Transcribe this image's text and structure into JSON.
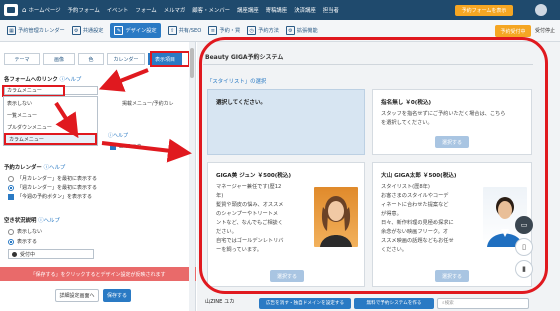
{
  "topbar": {
    "items": [
      "ホームページ",
      "予約フォーム",
      "イベント",
      "フォーム",
      "メルマガ",
      "顧客・メンバー",
      "講座講座",
      "寄稿講座",
      "決済講座",
      "担当者"
    ],
    "reserve_button": "予約フォームを表示",
    "home_icon": "home-icon"
  },
  "toolbar": {
    "items": [
      {
        "label": "予約管理カレンダー",
        "icon": "calendar-icon"
      },
      {
        "label": "共通設定",
        "icon": "gear-icon"
      },
      {
        "label": "デザイン設定",
        "icon": "brush-icon",
        "active": true
      },
      {
        "label": "共有/SEO",
        "icon": "share-icon"
      },
      {
        "label": "予約・買",
        "icon": "list-icon"
      },
      {
        "label": "予約方法",
        "icon": "clock-icon"
      },
      {
        "label": "拡張機能",
        "icon": "gear-icon"
      }
    ],
    "reserve_label": "予約受付中",
    "user_label": "受付停止"
  },
  "left_panel": {
    "tabs": [
      {
        "label": "テーマ",
        "active": false
      },
      {
        "label": "画像",
        "active": false
      },
      {
        "label": "色",
        "active": false
      },
      {
        "label": "カレンダー",
        "active": false
      },
      {
        "label": "表示項目",
        "active": true
      }
    ],
    "menu_link": {
      "label": "各フォームへのリンク",
      "help": "ヘルプ",
      "selected": "カラムメニュー",
      "options": [
        "表示しない",
        "一覧メニュー",
        "プルダウンメニュー",
        "カラムメニュー"
      ],
      "behind_text": "掲載メニュー/予約カレ"
    },
    "behind_help": "ヘルプ",
    "behind_check": "LINE ユカ",
    "calendar": {
      "label": "予約カレンダー",
      "help": "ヘルプ",
      "options": [
        {
          "label": "「月カレンダー」を最初に表示する",
          "checked": false
        },
        {
          "label": "「週カレンダー」を最初に表示する",
          "checked": true
        },
        {
          "label": "「今週の予約ボタン」を表示する",
          "checked": true
        }
      ]
    },
    "status": {
      "label": "空き状況説明",
      "help": "ヘルプ",
      "options": [
        {
          "label": "表示しない",
          "checked": false
        },
        {
          "label": "表示する",
          "checked": true
        }
      ],
      "slider_label": "受付中"
    },
    "warning": "「保存する」をクリックするとデザイン設定が反映されます",
    "detail_button": "詳細設定画面へ",
    "save_button": "保存する"
  },
  "preview": {
    "title": "Beauty GIGA予約システム",
    "subtitle": "「スタイリスト」の選択",
    "cards": [
      {
        "title": "選択してください。",
        "lines": [],
        "button": "",
        "highlight": true
      },
      {
        "title": "指名無し ￥0(税込)",
        "lines": [
          "スタッフを指名せずにご予約いただく場合は、こちら",
          "を選択してください。"
        ],
        "button": "選択する",
        "highlight": false
      },
      {
        "title": "GIGA美 ジュン ￥500(税込)",
        "lines": [
          "マネージャー兼任です(歴12",
          "年)",
          "髪質や頭皮の悩み、オススメ",
          "のシャンプーやトリートメ",
          "ントなど、なんでもご相談く",
          "ださい。",
          "自宅ではゴールデンレトリバ",
          "ーを飼っています。"
        ],
        "button": "選択する",
        "highlight": false
      },
      {
        "title": "大山 GIGA太郎 ￥500(税込)",
        "lines": [
          "スタイリスト(歴8年)",
          "お客さまのスタイルやコーデ",
          "ィネートに合わせた提案など",
          "が得意。",
          "日々、新作料理の見極め探求に",
          "余念がない映画フリーク。オ",
          "ススメ映画の話題などもお任せ",
          "ください。"
        ],
        "button": "選択する",
        "highlight": false
      }
    ],
    "bottom_text": "山ZINE ユカ",
    "footer_buttons": [
      "広告を消す・独自ドメインを設定する",
      "無料で予約システムを作る"
    ],
    "search_placeholder": "検索"
  },
  "colors": {
    "nav_bg": "#1f4a6d",
    "accent_blue": "#2a7ac4",
    "orange": "#f5a623",
    "annotation_red": "#e0191f",
    "warning_bg": "#e96a6a"
  }
}
